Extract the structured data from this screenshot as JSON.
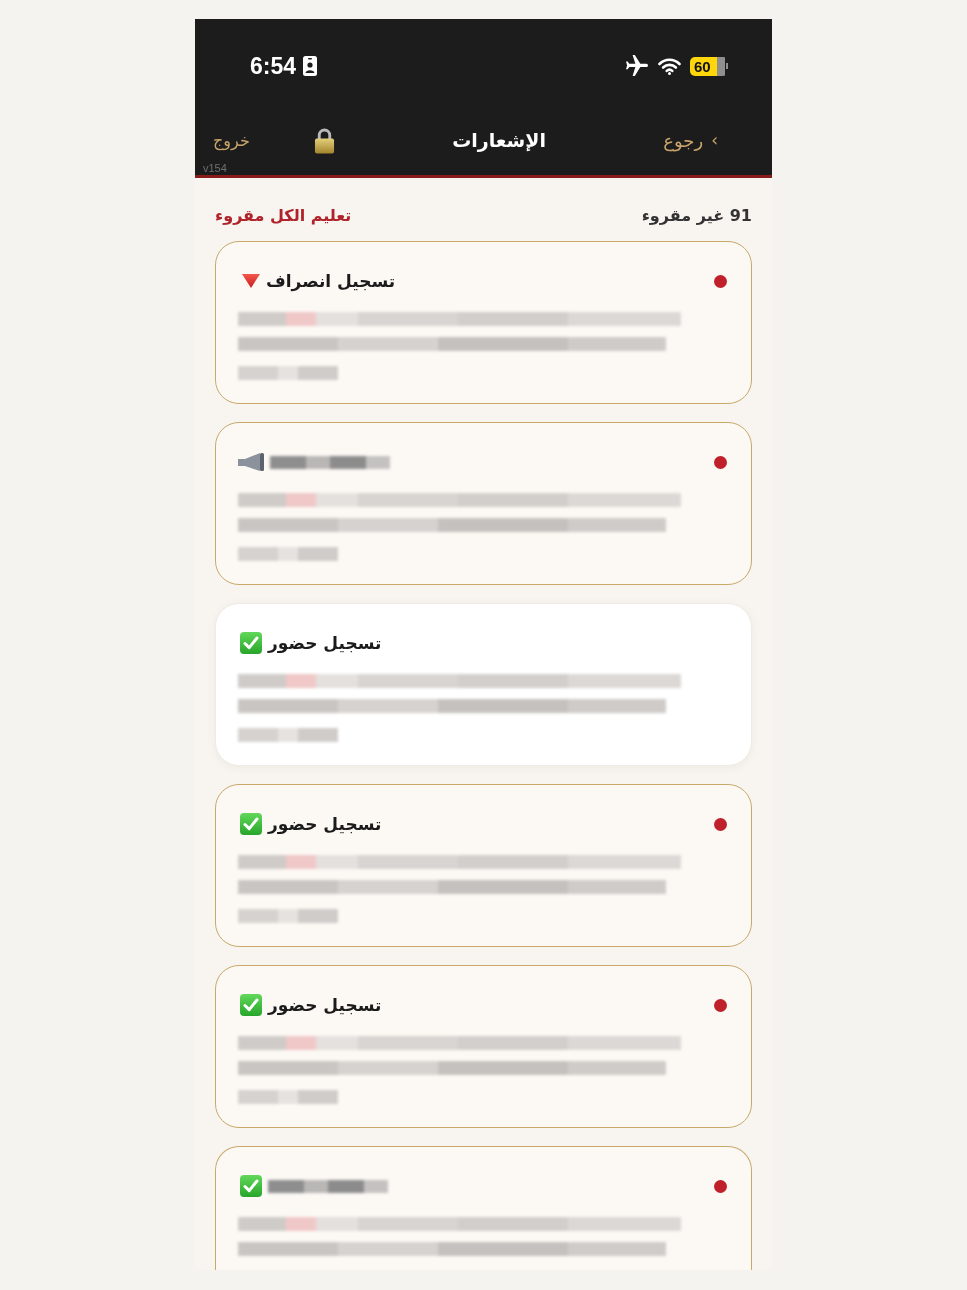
{
  "status_bar": {
    "time": "6:54",
    "battery": "60"
  },
  "nav": {
    "back": {
      "chevron": "‹",
      "label": "رجوع"
    },
    "title": "الإشعارات",
    "logout": "خروج",
    "version": "v154"
  },
  "summary": {
    "unread_count": "91 غير مقروء",
    "mark_all_read": "تعليم الكل مقروء"
  },
  "cards": [
    {
      "kind": "checkout",
      "title": "تسجيل انصراف",
      "unread": true,
      "cut_off": false
    },
    {
      "kind": "announcement",
      "unread": true,
      "cut_off": false
    },
    {
      "kind": "checkin",
      "title": "تسجيل حضور",
      "unread": false,
      "cut_off": false
    },
    {
      "kind": "checkin",
      "title": "تسجيل حضور",
      "unread": true,
      "cut_off": false
    },
    {
      "kind": "checkin",
      "title": "تسجيل حضور",
      "unread": true,
      "cut_off": false
    },
    {
      "kind": "checkin",
      "unread": true,
      "cut_off": true
    }
  ]
}
